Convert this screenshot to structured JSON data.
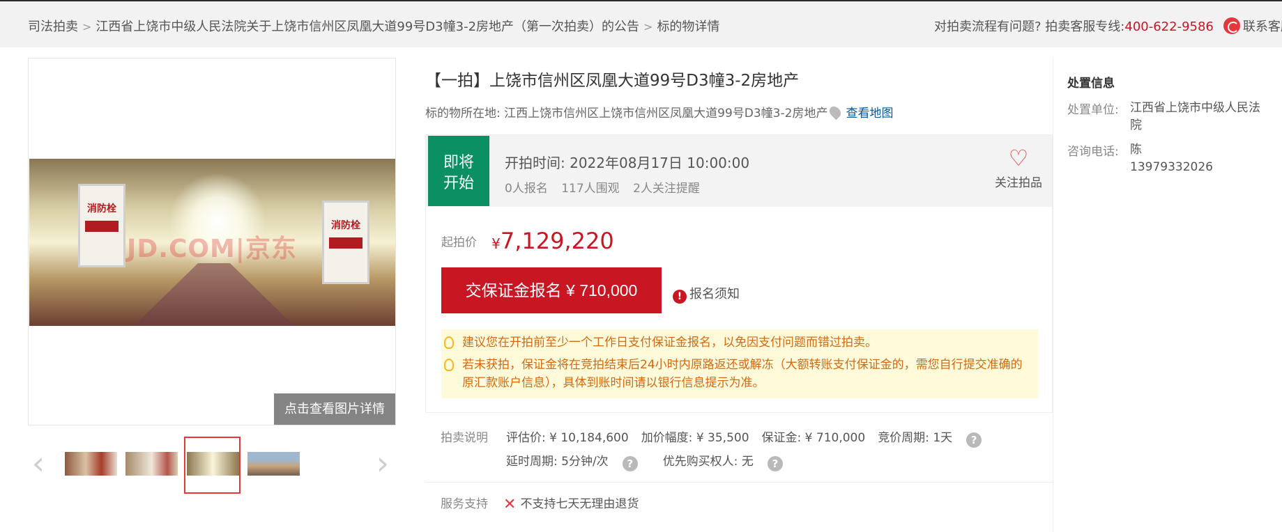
{
  "breadcrumb": {
    "items": [
      "司法拍卖",
      "江西省上饶市中级人民法院关于上饶市信州区凤凰大道99号D3幢3-2房地产（第一次拍卖）的公告",
      "标的物详情"
    ],
    "separator": ">"
  },
  "help": {
    "question": "对拍卖流程有问题?",
    "hotline_label": "拍卖客服专线:",
    "hotline": "400-622-9586",
    "contact_label": "联系客服"
  },
  "gallery": {
    "watermark": "JD.COM|京东",
    "sign_left": "消防栓",
    "sign_right": "消防栓",
    "view_detail": "点击查看图片详情",
    "prev_icon": "‹",
    "next_icon": "›"
  },
  "item": {
    "title": "【一拍】上饶市信州区凤凰大道99号D3幢3-2房地产",
    "location_label": "标的物所在地:",
    "location": "江西上饶市信州区上饶市信州区凤凰大道99号D3幢3-2房地产",
    "map_link": "查看地图"
  },
  "auction": {
    "status_line1": "即将",
    "status_line2": "开始",
    "start_label": "开拍时间:",
    "start_time": "2022年08月17日 10:00:00",
    "signups": "0人报名",
    "views": "117人围观",
    "reminders": "2人关注提醒",
    "follow_label": "关注拍品",
    "start_price_label": "起拍价",
    "currency": "¥",
    "start_price": "7,129,220",
    "signup_button": "交保证金报名 ¥ 710,000",
    "notice_label": "报名须知"
  },
  "tips": [
    "建议您在开拍前至少一个工作日支付保证金报名，以免因支付问题而错过拍卖。",
    "若未获拍，保证金将在竞拍结束后24小时内原路返还或解冻（大额转账支付保证金的，需您自行提交准确的原汇款账户信息），具体到账时间请以银行信息提示为准。"
  ],
  "description": {
    "label": "拍卖说明",
    "appraisal": "评估价: ¥ 10,184,600",
    "increment": "加价幅度: ¥ 35,500",
    "deposit": "保证金: ¥ 710,000",
    "period": "竞价周期: 1天",
    "delay": "延时周期: 5分钟/次",
    "priority": "优先购买权人: 无"
  },
  "service": {
    "label": "服务支持",
    "text": "不支持七天无理由退货"
  },
  "side": {
    "title": "处置信息",
    "unit_label": "处置单位:",
    "unit": "江西省上饶市中级人民法院",
    "contact_label": "咨询电话:",
    "contact_name": "陈",
    "contact_phone": "13979332026"
  },
  "colors": {
    "brand_red": "#c81623",
    "status_green": "#0a9062",
    "link_blue": "#005aa0",
    "tip_orange": "#d36a12"
  }
}
